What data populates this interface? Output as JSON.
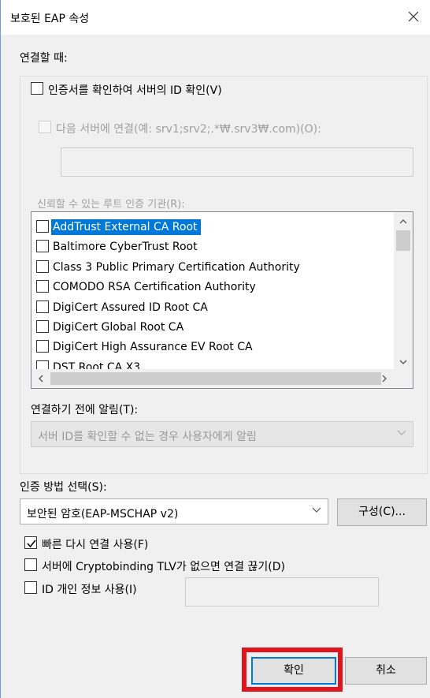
{
  "window": {
    "title": "보호된 EAP 속성"
  },
  "connect_section": {
    "heading": "연결할 때:",
    "verify_cert_label": "인증서를 확인하여 서버의 ID 확인(V)",
    "connect_servers_label": "다음 서버에 연결(예: srv1;srv2;.*₩.srv3₩.com)(O):",
    "servers_value": "",
    "trusted_ca_label": "신뢰할 수 있는 루트 인증 기관(R):",
    "ca_list": [
      {
        "label": "AddTrust External CA Root",
        "selected": true,
        "checked": false
      },
      {
        "label": "Baltimore CyberTrust Root",
        "selected": false,
        "checked": false
      },
      {
        "label": "Class 3 Public Primary Certification Authority",
        "selected": false,
        "checked": false
      },
      {
        "label": "COMODO RSA Certification Authority",
        "selected": false,
        "checked": false
      },
      {
        "label": "DigiCert Assured ID Root CA",
        "selected": false,
        "checked": false
      },
      {
        "label": "DigiCert Global Root CA",
        "selected": false,
        "checked": false
      },
      {
        "label": "DigiCert High Assurance EV Root CA",
        "selected": false,
        "checked": false
      },
      {
        "label": "DST Root CA X3",
        "selected": false,
        "checked": false
      }
    ],
    "notify_label": "연결하기 전에 알림(T):",
    "notify_value": "서버 ID를 확인할 수 없는 경우 사용자에게 알림"
  },
  "auth_section": {
    "method_label": "인증 방법 선택(S):",
    "method_value": "보안된 암호(EAP-MSCHAP v2)",
    "configure_button": "구성(C)...",
    "fast_reconnect_label": "빠른 다시 연결 사용(F)",
    "fast_reconnect_checked": true,
    "cryptobinding_label": "서버에 Cryptobinding TLV가 없으면 연결 끊기(D)",
    "identity_privacy_label": "ID 개인 정보 사용(I)",
    "identity_value": ""
  },
  "buttons": {
    "ok": "확인",
    "cancel": "취소"
  },
  "colors": {
    "accent": "#0078d7",
    "highlight": "#e0141c"
  }
}
